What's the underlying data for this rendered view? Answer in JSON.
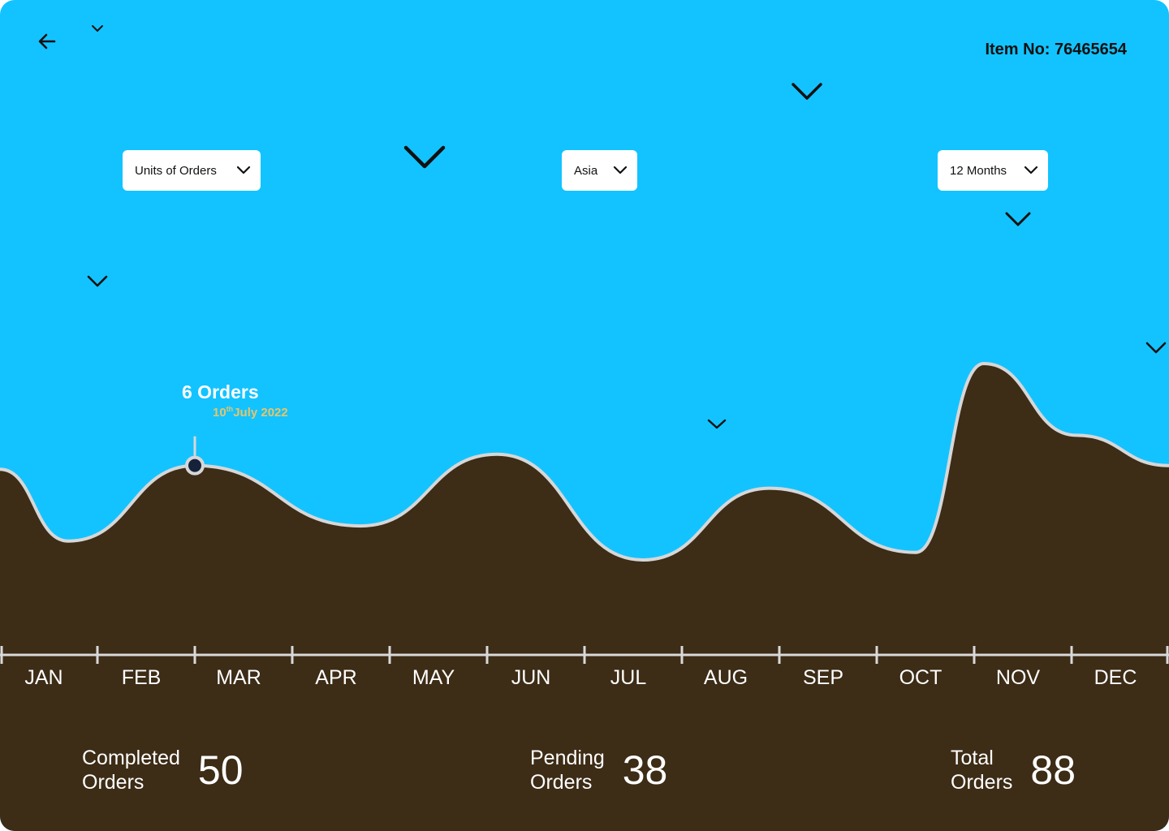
{
  "header": {
    "item_no": "Item No: 76465654"
  },
  "filters": {
    "metric": "Units of Orders",
    "region": "Asia",
    "period": "12 Months"
  },
  "tooltip": {
    "value": "6 Orders",
    "day": "10",
    "day_suffix": "th",
    "rest": "July 2022"
  },
  "colors": {
    "sky": "#13c3ff",
    "area": "#3d2c16",
    "curve": "#d7d7d7",
    "marker": "#16213a",
    "date": "#e8c46a"
  },
  "chart_data": {
    "type": "area",
    "categories": [
      "JAN",
      "FEB",
      "MAR",
      "APR",
      "MAY",
      "JUN",
      "JUL",
      "AUG",
      "SEP",
      "OCT",
      "NOV",
      "DEC"
    ],
    "x": [
      0,
      0.7,
      2,
      3.7,
      5.1,
      6.6,
      7.9,
      9.4,
      10.1,
      11.05,
      12
    ],
    "values": [
      4.7,
      2.8,
      4.8,
      3.2,
      5.1,
      2.3,
      4.2,
      2.5,
      7.5,
      5.6,
      4.8
    ],
    "highlight": {
      "x": 2,
      "value": 4.8,
      "label": "6 Orders",
      "date": "10th July 2022"
    }
  },
  "stats": [
    {
      "label_1": "Completed",
      "label_2": "Orders",
      "value": "50"
    },
    {
      "label_1": "Pending",
      "label_2": "Orders",
      "value": "38"
    },
    {
      "label_1": "Total",
      "label_2": "Orders",
      "value": "88"
    }
  ]
}
